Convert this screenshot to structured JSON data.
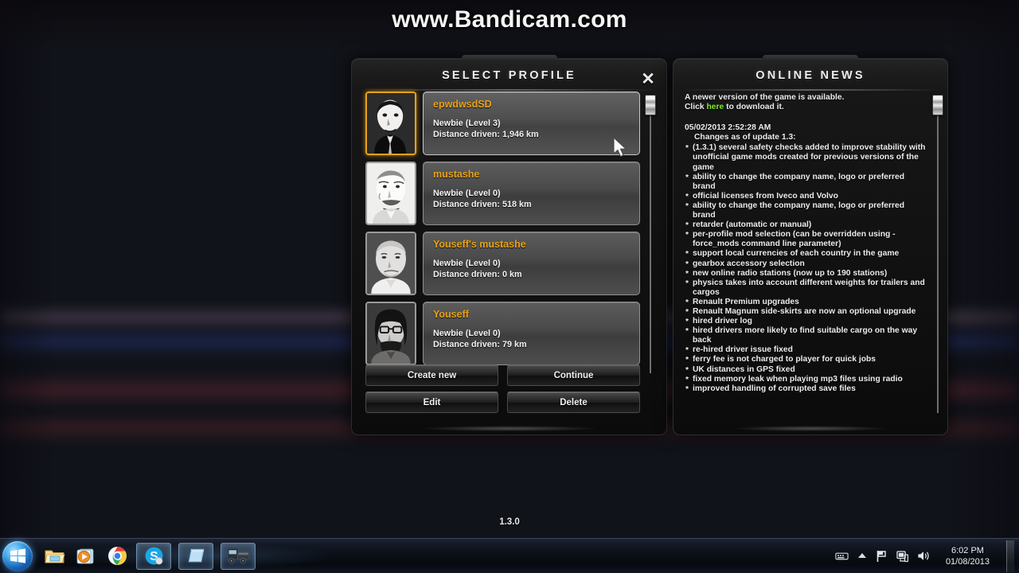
{
  "watermark": "www.Bandicam.com",
  "version": "1.3.0",
  "profile_panel": {
    "title": "SELECT PROFILE",
    "close_icon": "close-icon",
    "profiles": [
      {
        "name": "epwdwsdSD",
        "level": "Newbie (Level 3)",
        "distance": "Distance driven: 1,946 km",
        "selected": true
      },
      {
        "name": "mustashe",
        "level": "Newbie (Level 0)",
        "distance": "Distance driven: 518 km",
        "selected": false
      },
      {
        "name": "Youseff's mustashe",
        "level": "Newbie (Level 0)",
        "distance": "Distance driven: 0 km",
        "selected": false
      },
      {
        "name": "Youseff",
        "level": "Newbie (Level 0)",
        "distance": "Distance driven: 79 km",
        "selected": false
      }
    ],
    "buttons": {
      "create_new": "Create new",
      "continue": "Continue",
      "edit": "Edit",
      "delete": "Delete"
    }
  },
  "news_panel": {
    "title": "ONLINE NEWS",
    "intro_line1": "A newer version of the game is available.",
    "intro_click": "Click",
    "intro_link": "here",
    "intro_rest": "to download it.",
    "date": "05/02/2013 2:52:28 AM",
    "subtitle": "Changes as of update 1.3:",
    "items": [
      "(1.3.1) several safety checks added to improve stability with unofficial game mods created for previous versions of the game",
      "ability to change the company name, logo or preferred brand",
      "official licenses from Iveco and Volvo",
      "ability to change the company name, logo or preferred brand",
      "retarder (automatic or manual)",
      "per-profile mod selection (can be overridden using -force_mods command line parameter)",
      "support local currencies of each country in the game",
      "gearbox accessory selection",
      "new online radio stations (now up to 190 stations)",
      "physics takes into account different weights for trailers and cargos",
      "Renault Premium upgrades",
      "Renault Magnum side-skirts are now an optional upgrade",
      "hired driver log",
      "hired drivers more likely to find suitable cargo on the way back",
      "re-hired driver issue fixed",
      "ferry fee is not charged to player for quick jobs",
      "UK distances in GPS fixed",
      "fixed memory leak when playing mp3 files using radio",
      "improved handling of corrupted save files"
    ]
  },
  "taskbar": {
    "start": "start-orb",
    "items": [
      {
        "icon": "windows-explorer-icon",
        "active": false
      },
      {
        "icon": "windows-media-player-icon",
        "active": false
      },
      {
        "icon": "google-chrome-icon",
        "active": false
      },
      {
        "icon": "skype-icon",
        "active": true
      },
      {
        "icon": "notepad-icon",
        "active": true
      },
      {
        "icon": "euro-truck-simulator-icon",
        "active": true
      }
    ],
    "tray": [
      "keyboard-layout-icon",
      "show-hidden-icons-icon",
      "action-center-flag-icon",
      "network-icon",
      "volume-icon"
    ],
    "time": "6:02 PM",
    "date": "01/08/2013"
  },
  "colors": {
    "accent_gold": "#e8a317",
    "link_green": "#7cf01a",
    "panel_bg": "#141414"
  }
}
